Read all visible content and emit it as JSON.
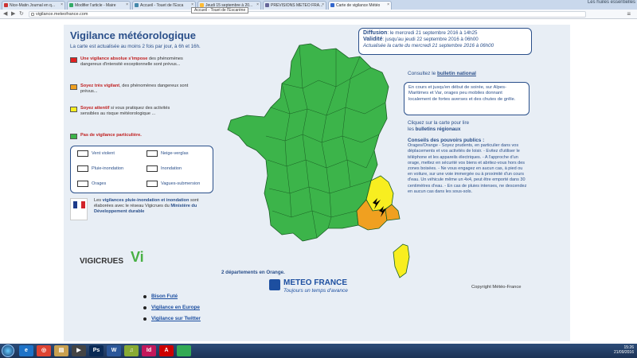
{
  "tabs": [
    {
      "label": "Nice-Matin Journal en q...",
      "color": "#c33"
    },
    {
      "label": "Modifier l'article - Maire",
      "color": "#3a6"
    },
    {
      "label": "Accueil - Touet de l'Esca",
      "color": "#48a"
    },
    {
      "label": "Jeudi 15 septembre à 20...",
      "color": "#fb3"
    },
    {
      "label": "PREVISIONS METEO FRA...",
      "color": "#669"
    },
    {
      "label": "Carte de vigilance Météo",
      "color": "#36c"
    }
  ],
  "tooltip": "Accueil - Touet de l'Escarène",
  "window_right_label": "Les huiles essentielles",
  "address_bar": {
    "url": "vigilance.meteofrance.com"
  },
  "page": {
    "title": "Vigilance météorologique",
    "subtitle": "La carte est actualisée au moins 2 fois par jour, à 6h et 16h.",
    "legend": [
      {
        "color": "#e02020",
        "bold": "Une vigilance absolue s'impose",
        "text": "des phénomènes dangereux d'intensité exceptionnelle sont prévus..."
      },
      {
        "color": "#f0a020",
        "bold": "Soyez très vigilant",
        "text": ", des phénomènes dangereux sont prévus..."
      },
      {
        "color": "#f8ee20",
        "bold": "Soyez attentif",
        "text": "si vous pratiquez des activités sensibles au risque météorologique ..."
      },
      {
        "color": "#3cb44a",
        "bold": "Pas de vigilance particulière.",
        "text": ""
      }
    ],
    "phenomena": [
      {
        "label": "Vent violent",
        "icon": "wind-icon"
      },
      {
        "label": "Neige-verglas",
        "icon": "snow-icon"
      },
      {
        "label": "Pluie-inondation",
        "icon": "rain-flood-icon"
      },
      {
        "label": "Inondation",
        "icon": "flood-icon"
      },
      {
        "label": "Orages",
        "icon": "storm-icon"
      },
      {
        "label": "Vagues-submersion",
        "icon": "wave-icon"
      }
    ],
    "ministry_pre": "Les",
    "ministry_bold": "vigilances pluie-inondation et inondation",
    "ministry_mid": "sont élaborées avec le réseau Vigicrues du",
    "ministry_org": "Ministère du Développement durable",
    "vigicrues": "VIGICRUES",
    "vigicrues_logo": "Vi",
    "dept_count": "2 départements en Orange.",
    "meteo_france": {
      "name": "METEO FRANCE",
      "tagline": "Toujours un temps d'avance"
    },
    "copyright": "Copyright Météo-France",
    "diffusion": {
      "label1": "Diffusion",
      "value1": ": le mercredi 21 septembre 2016 à 14h25",
      "label2": "Validité",
      "value2": ": jusqu'au jeudi 22 septembre 2016 à 06h00",
      "next": "Actualisée la carte du mercredi 21 septembre 2016 à 06h00"
    },
    "consult_prefix": "Consultez le",
    "consult_link": "bulletin national",
    "event_text": "En cours et jusqu'en début de soirée, sur Alpes-Maritimes et Var, orages peu mobiles donnant localement de fortes averses et des chutes de grêle.",
    "regional_line1": "Cliquez sur la carte pour lire",
    "regional_line2_prefix": "les",
    "regional_line2_bold": "bulletins régionaux",
    "advice_title": "Conseils des pouvoirs publics :",
    "advice_text": "Orages/Orange - Soyez prudents, en particulier dans vos déplacements et vos activités de loisir. - Evitez d'utiliser le téléphone et les appareils électriques. - A l'approche d'un orage, mettez en sécurité vos biens et abritez-vous hors des zones boisées. - Ne vous engagez en aucun cas, à pied ou en voiture, sur une voie immergée ou à proximité d'un cours d'eau. Un véhicule même un 4x4, peut être emporté dans 30 centimètres d'eau. - En cas de pluies intenses, ne descendez en aucun cas dans les sous-sols.",
    "links": [
      "Bison Futé",
      "Vigilance en Europe",
      "Vigilance sur Twitter"
    ]
  },
  "taskbar": {
    "apps": [
      {
        "label": "e",
        "color": "#1e73c8"
      },
      {
        "label": "◎",
        "color": "#d43"
      },
      {
        "label": "▤",
        "color": "#c8a050"
      },
      {
        "label": "▶",
        "color": "#444"
      },
      {
        "label": "Ps",
        "color": "#0a2a55"
      },
      {
        "label": "W",
        "color": "#2b579a"
      },
      {
        "label": "♫",
        "color": "#8a3"
      },
      {
        "label": "Id",
        "color": "#c2185b"
      },
      {
        "label": "A",
        "color": "#c00"
      },
      {
        "label": "",
        "color": "#3a5"
      }
    ],
    "time": "15:26",
    "date": "21/09/2016"
  },
  "colors": {
    "green": "#3cb44a",
    "yellow": "#f8ee20",
    "orange": "#f0a020",
    "accent": "#2a4f8a"
  }
}
